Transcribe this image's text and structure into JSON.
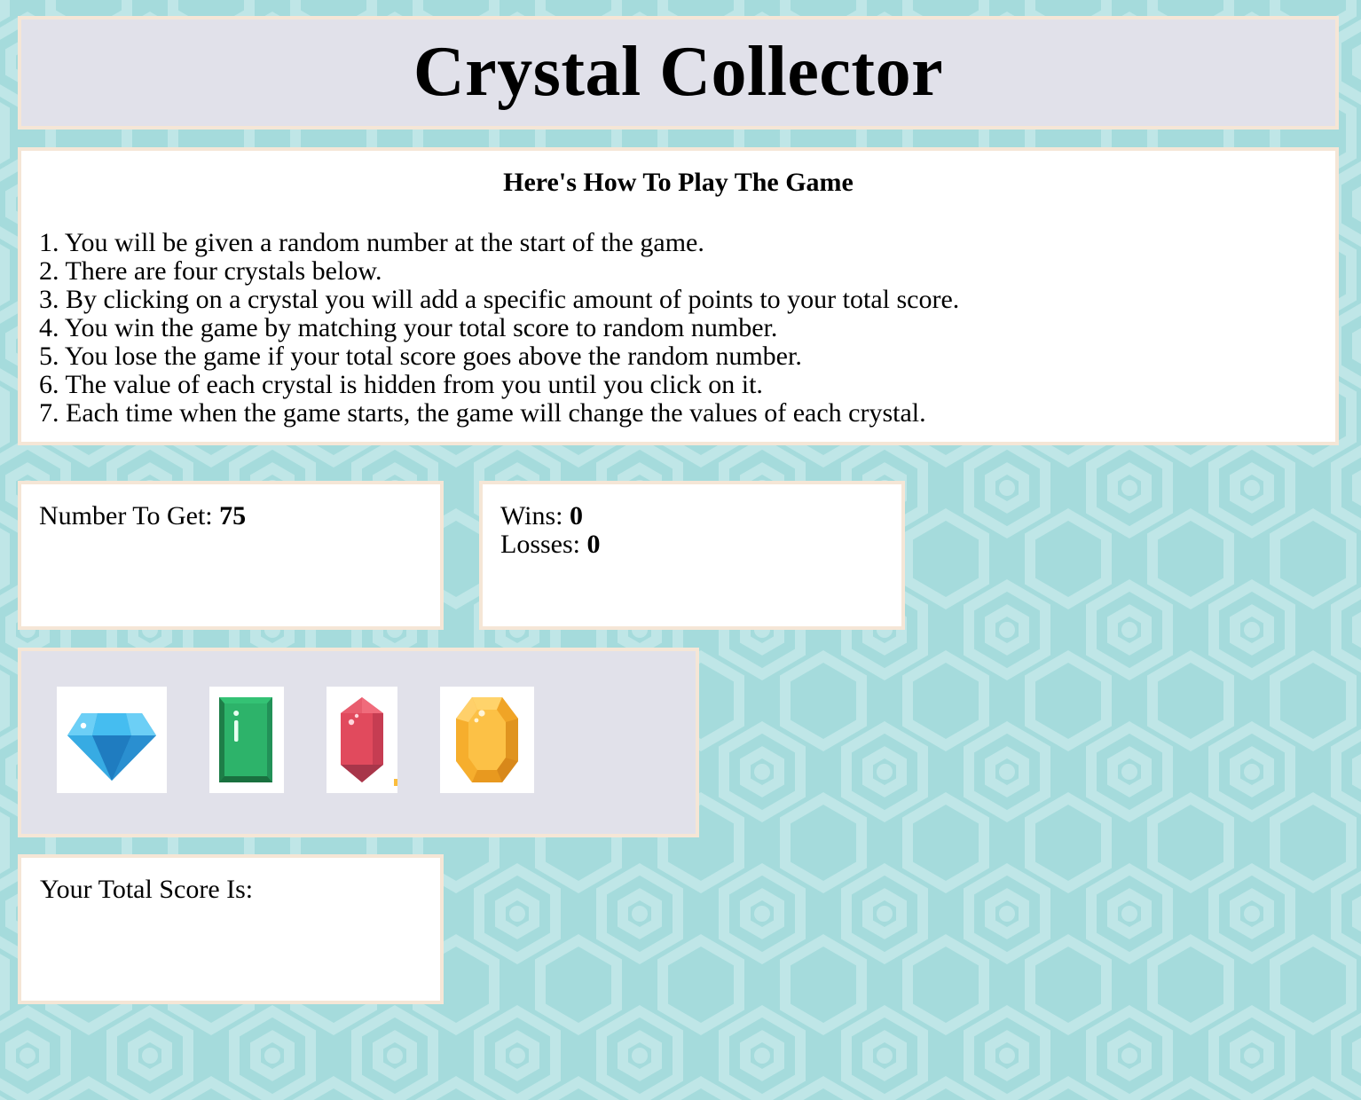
{
  "title": "Crystal Collector",
  "instructions": {
    "heading": "Here's How To Play The Game",
    "steps": [
      "1. You will be given a random number at the start of the game.",
      "2. There are four crystals below.",
      "3. By clicking on a crystal you will add a specific amount of points to your total score.",
      "4. You win the game by matching your total score to random number.",
      "5. You lose the game if your total score goes above the random number.",
      "6. The value of each crystal is hidden from you until you click on it.",
      "7. Each time when the game starts, the game will change the values of each crystal."
    ]
  },
  "target": {
    "label": "Number To Get: ",
    "value": "75"
  },
  "stats": {
    "wins_label": "Wins: ",
    "wins": "0",
    "losses_label": "Losses: ",
    "losses": "0"
  },
  "crystals": [
    {
      "name": "diamond",
      "icon": "blue-diamond-icon",
      "color": "#29abe2"
    },
    {
      "name": "emerald",
      "icon": "green-emerald-icon",
      "color": "#27a35a"
    },
    {
      "name": "ruby",
      "icon": "red-ruby-icon",
      "color": "#e04b5c"
    },
    {
      "name": "topaz",
      "icon": "yellow-topaz-icon",
      "color": "#fbbd3d"
    }
  ],
  "score": {
    "label": "Your Total Score Is:",
    "value": ""
  },
  "colors": {
    "background": "#a5dbdc",
    "pattern": "#c6eaea",
    "panel_white": "#ffffff",
    "panel_lavender": "#e1e1ea",
    "panel_border": "#f5e6d6"
  }
}
